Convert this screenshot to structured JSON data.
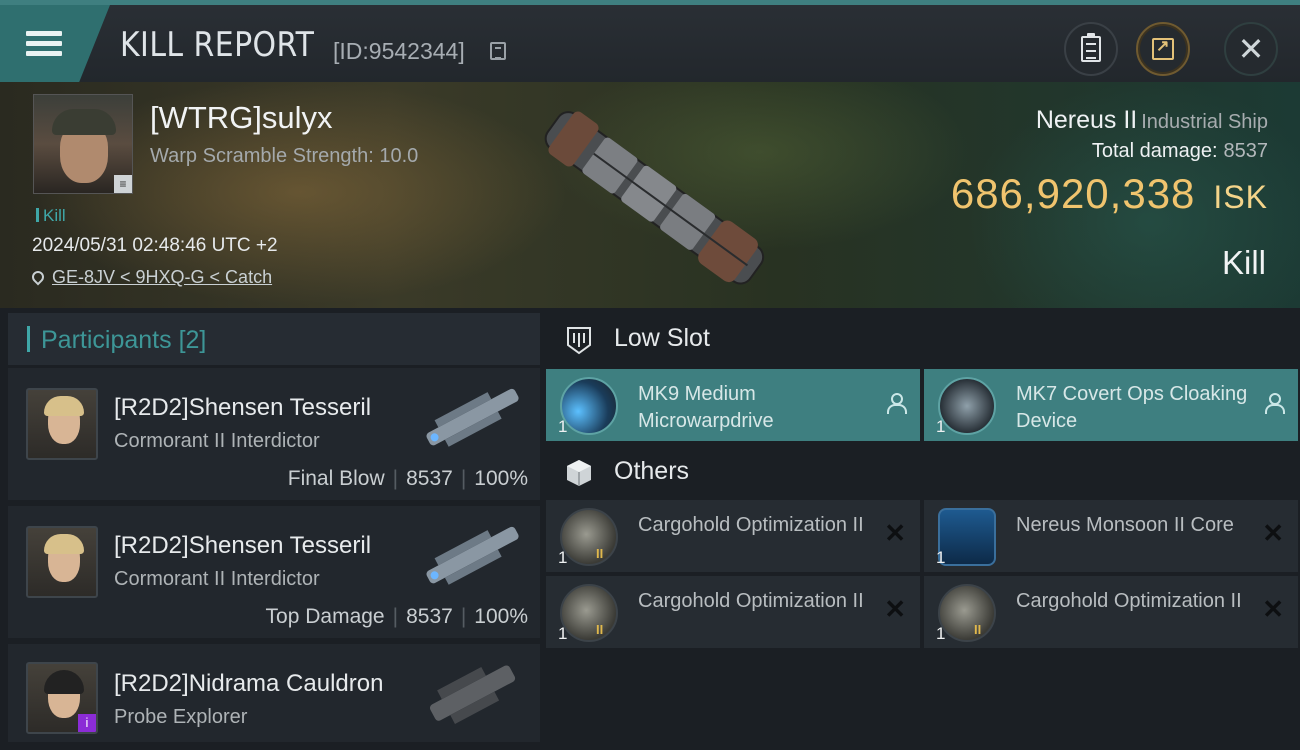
{
  "header": {
    "title": "KILL REPORT",
    "report_id": "[ID:9542344]"
  },
  "victim": {
    "name": "[WTRG]sulyx",
    "warp_scramble": "Warp Scramble Strength: 10.0",
    "kill_tag": "Kill",
    "timestamp": "2024/05/31 02:48:46 UTC +2",
    "location": "GE-8JV < 9HXQ-G < Catch",
    "ship_name": "Nereus II",
    "ship_class": "Industrial Ship",
    "total_damage_label": "Total damage:",
    "total_damage": "8537",
    "isk_value": "686,920,338",
    "isk_unit": "ISK",
    "outcome": "Kill"
  },
  "participants": {
    "title": "Participants",
    "count": "[2]",
    "items": [
      {
        "name": "[R2D2]Shensen Tesseril",
        "ship": "Cormorant II Interdictor",
        "role": "Final Blow",
        "damage": "8537",
        "percent": "100%"
      },
      {
        "name": "[R2D2]Shensen Tesseril",
        "ship": "Cormorant II Interdictor",
        "role": "Top Damage",
        "damage": "8537",
        "percent": "100%"
      },
      {
        "name": "[R2D2]Nidrama Cauldron",
        "ship": "Probe Explorer"
      }
    ]
  },
  "fitting": {
    "low_slot": {
      "title": "Low Slot",
      "modules": [
        {
          "qty": "1",
          "name": "MK9 Medium Microwarpdrive",
          "icon": "microwarpdrive-icon"
        },
        {
          "qty": "1",
          "name": "MK7 Covert Ops Cloaking Device",
          "icon": "cloaking-device-icon"
        }
      ]
    },
    "others": {
      "title": "Others",
      "modules": [
        {
          "qty": "1",
          "name": "Cargohold Optimization II",
          "tech": "II",
          "icon": "cargohold-icon"
        },
        {
          "qty": "1",
          "name": "Nereus Monsoon II Core",
          "icon": "core-icon"
        },
        {
          "qty": "1",
          "name": "Cargohold Optimization II",
          "tech": "II",
          "icon": "cargohold-icon"
        },
        {
          "qty": "1",
          "name": "Cargohold Optimization II",
          "tech": "II",
          "icon": "cargohold-icon"
        }
      ]
    }
  },
  "colors": {
    "accent_teal": "#3fa7a8",
    "active_slot": "#3e7f80",
    "isk_gold": "#f0c46e"
  }
}
